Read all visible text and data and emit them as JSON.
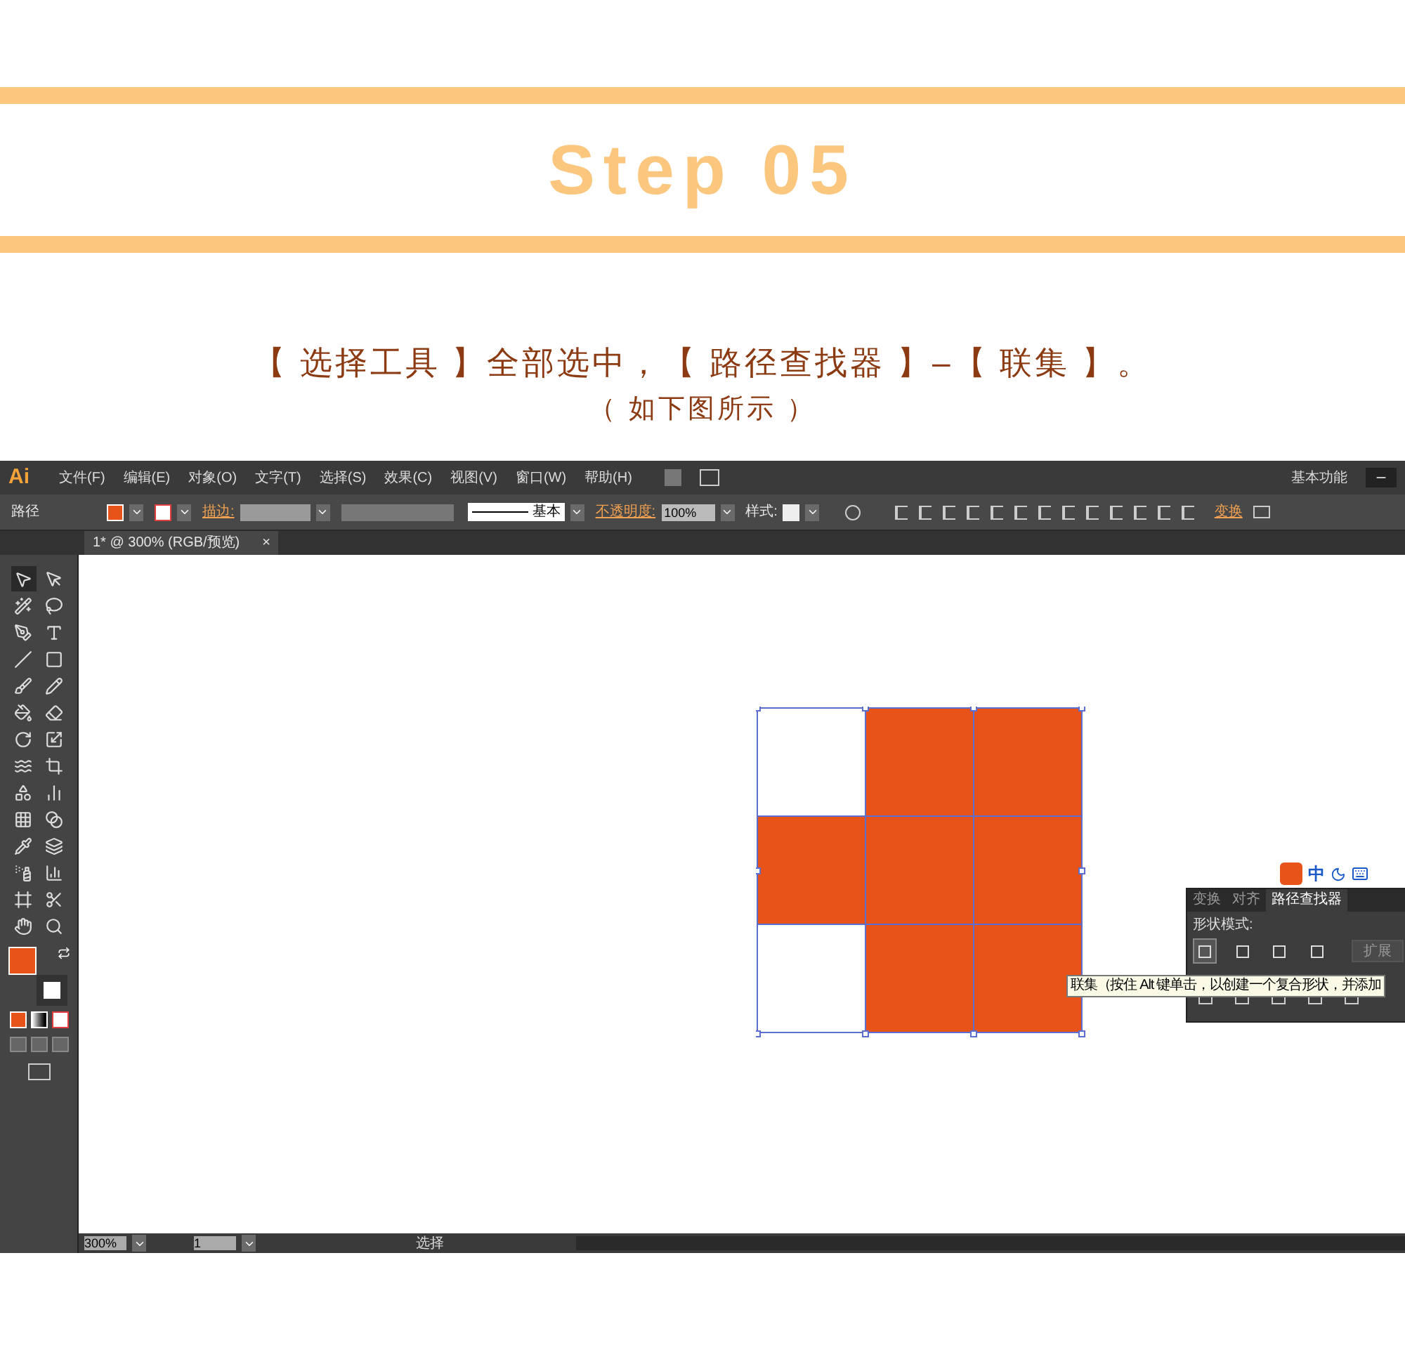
{
  "header": {
    "title": "Step 05"
  },
  "instruction": "【 选择工具 】全部选中，【 路径查找器 】–【 联集 】。",
  "caption": "（ 如下图所示 ）",
  "app": {
    "logo": "Ai",
    "menus": [
      "文件(F)",
      "编辑(E)",
      "对象(O)",
      "文字(T)",
      "选择(S)",
      "效果(C)",
      "视图(V)",
      "窗口(W)",
      "帮助(H)"
    ],
    "workspace": "基本功能",
    "control_bar": {
      "object_label": "路径",
      "stroke_label": "描边:",
      "stroke_profile": "基本",
      "opacity_label": "不透明度:",
      "opacity_value": "100%",
      "style_label": "样式:",
      "transform_label": "变换"
    },
    "document_tab": {
      "title": "1* @ 300% (RGB/预览)",
      "close": "×"
    },
    "canvas": {
      "cells": [
        {
          "filled": false
        },
        {
          "filled": true
        },
        {
          "filled": true
        },
        {
          "filled": true
        },
        {
          "filled": true
        },
        {
          "filled": true
        },
        {
          "filled": false
        },
        {
          "filled": true
        },
        {
          "filled": true
        }
      ]
    },
    "ime_bar": {
      "label": "中"
    },
    "pathfinder": {
      "tabs": [
        {
          "label": "变换",
          "selected": false
        },
        {
          "label": "对齐",
          "selected": false
        },
        {
          "label": "路径查找器",
          "selected": true
        }
      ],
      "shape_modes_label": "形状模式:",
      "shape_modes": [
        {
          "selected": true
        },
        {
          "selected": false
        },
        {
          "selected": false
        },
        {
          "selected": false
        }
      ],
      "expand": "扩展"
    },
    "tooltip": "联集（按住 Alt 键单击，以创建一个复合形状，并添加",
    "status_bar": {
      "zoom": "300%",
      "page": "1",
      "status": "选择"
    }
  }
}
